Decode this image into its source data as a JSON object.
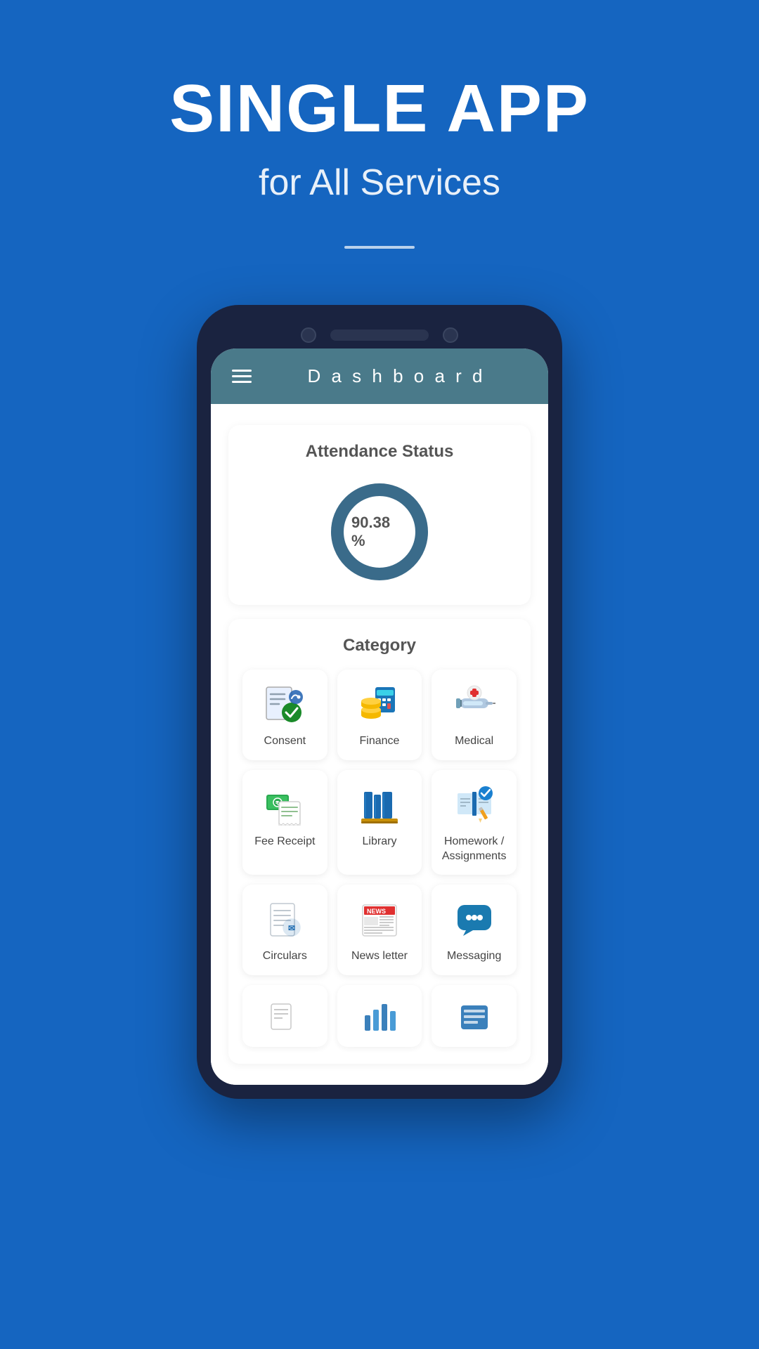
{
  "hero": {
    "title": "SINGLE APP",
    "subtitle": "for All Services"
  },
  "app": {
    "header_title": "D a s h b o a r d"
  },
  "attendance": {
    "section_title": "Attendance Status",
    "percentage": "90.38 %"
  },
  "category": {
    "title": "Category",
    "items": [
      {
        "id": "consent",
        "label": "Consent",
        "icon": "consent"
      },
      {
        "id": "finance",
        "label": "Finance",
        "icon": "finance"
      },
      {
        "id": "medical",
        "label": "Medical",
        "icon": "medical"
      },
      {
        "id": "fee-receipt",
        "label": "Fee Receipt",
        "icon": "fee-receipt"
      },
      {
        "id": "library",
        "label": "Library",
        "icon": "library"
      },
      {
        "id": "homework",
        "label": "Homework / Assignments",
        "icon": "homework"
      },
      {
        "id": "circulars",
        "label": "Circulars",
        "icon": "circulars"
      },
      {
        "id": "newsletter",
        "label": "News letter",
        "icon": "newsletter"
      },
      {
        "id": "messaging",
        "label": "Messaging",
        "icon": "messaging"
      }
    ],
    "partial_items": [
      {
        "id": "item-a",
        "label": "...",
        "icon": "docs"
      },
      {
        "id": "item-b",
        "label": "...",
        "icon": "chart"
      },
      {
        "id": "item-c",
        "label": "...",
        "icon": "list"
      }
    ]
  },
  "icons": {
    "hamburger": "☰"
  }
}
